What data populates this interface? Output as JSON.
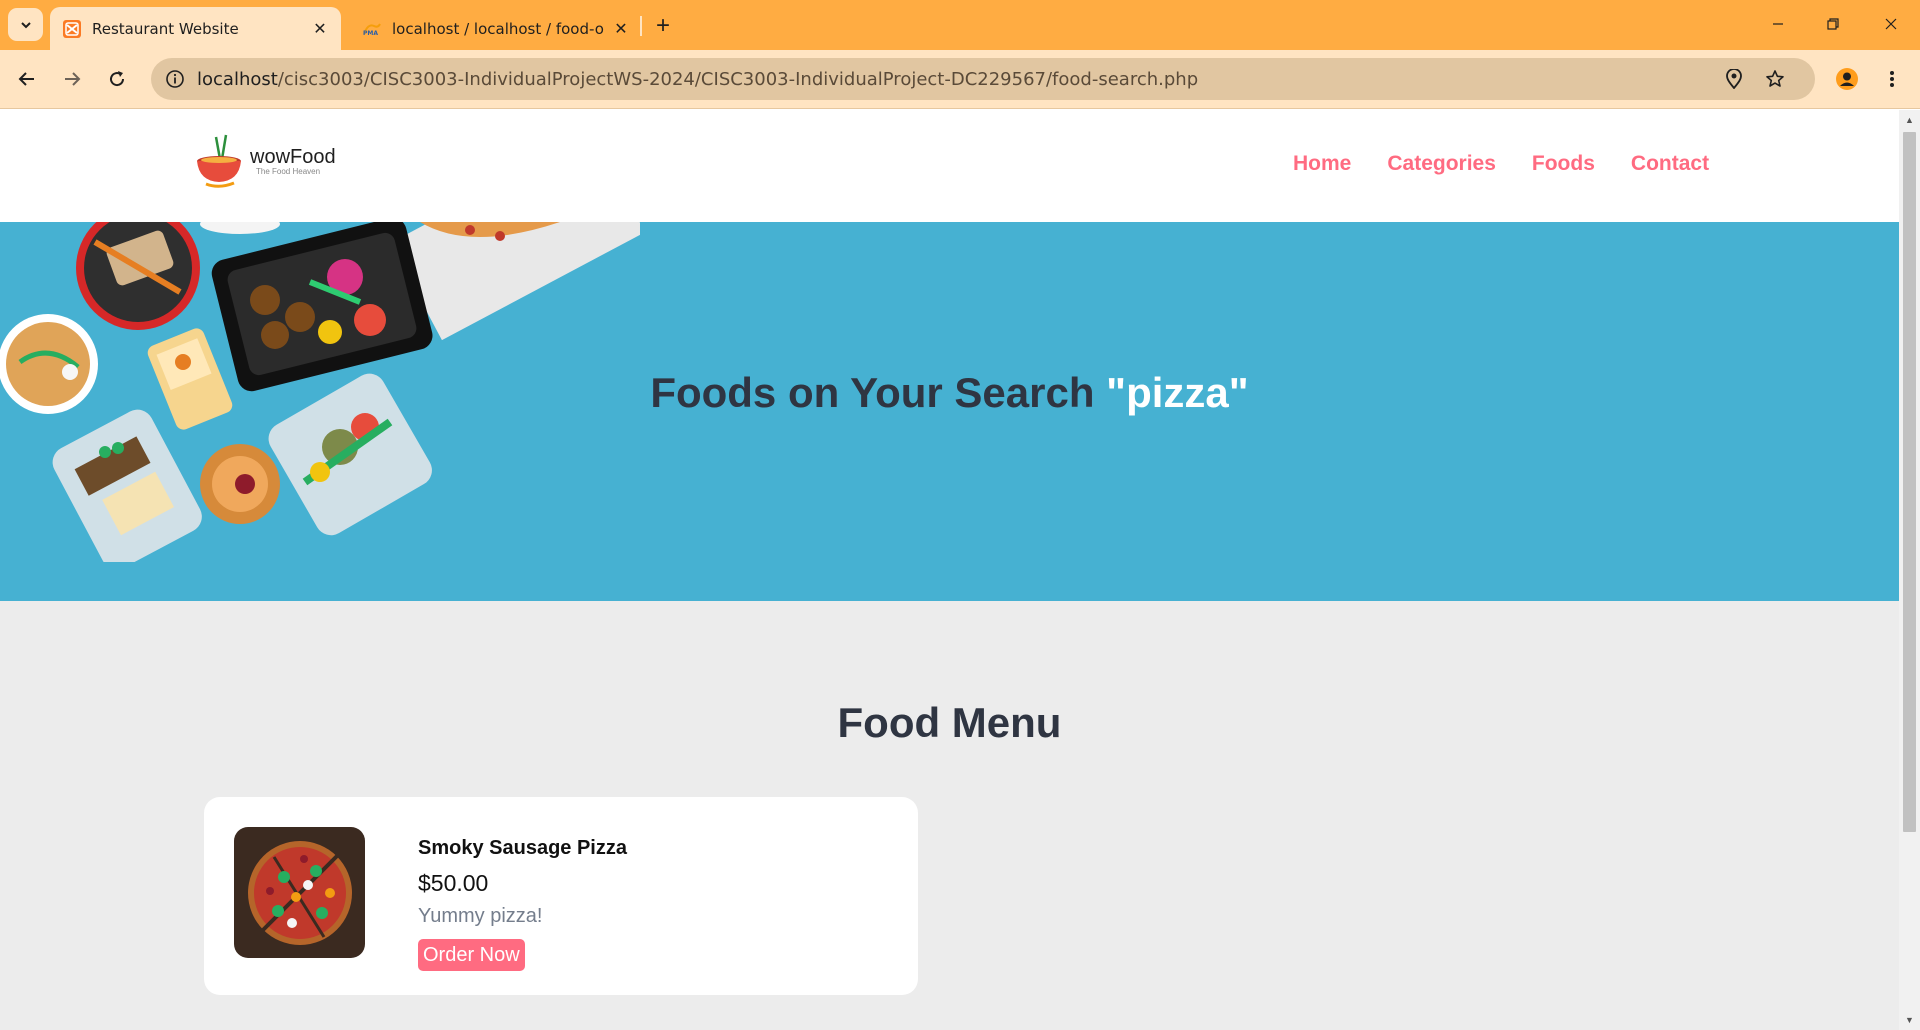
{
  "browser": {
    "tabs": [
      {
        "title": "Restaurant Website",
        "active": true,
        "favicon": "xampp-icon"
      },
      {
        "title": "localhost / localhost / food-o",
        "active": false,
        "favicon": "phpmyadmin-icon"
      }
    ],
    "address": {
      "host": "localhost",
      "path": "/cisc3003/CISC3003-IndividualProjectWS-2024/CISC3003-IndividualProject-DC229567/food-search.php"
    },
    "colors": {
      "tabbar": "#ffac42",
      "toolbar": "#ffe4c2",
      "omnibox": "#e1c6a1"
    }
  },
  "site": {
    "logo": {
      "name": "wowFood",
      "tagline": "The Food Heaven"
    },
    "nav": [
      "Home",
      "Categories",
      "Foods",
      "Contact"
    ],
    "colors": {
      "accent": "#ff6b81",
      "hero": "#46b1d2",
      "heading": "#2f3542"
    }
  },
  "search": {
    "heading_prefix": "Foods on Your Search ",
    "query_display": "\"pizza\""
  },
  "food_menu": {
    "title": "Food Menu",
    "items": [
      {
        "name": "Smoky Sausage Pizza",
        "price": "$50.00",
        "description": "Yummy pizza!",
        "button": "Order Now"
      }
    ]
  }
}
